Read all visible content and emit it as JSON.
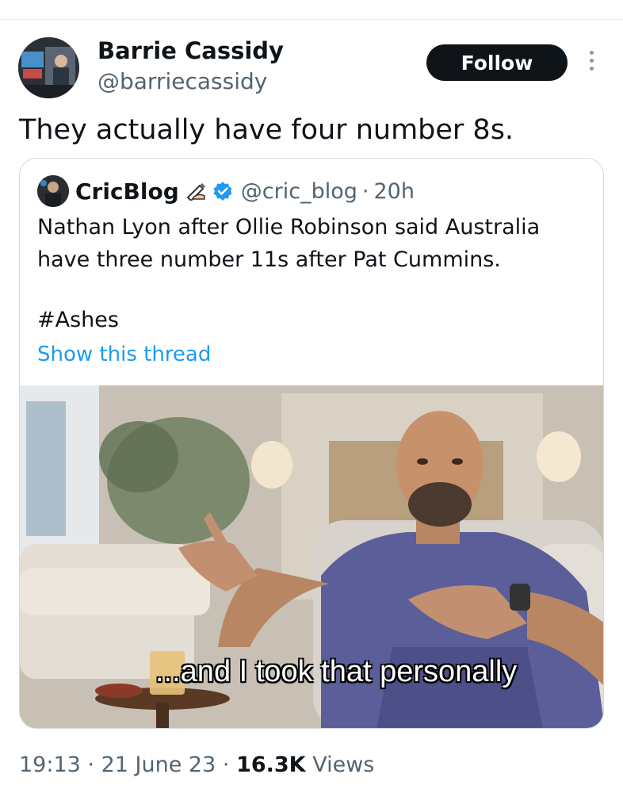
{
  "post": {
    "author_name": "Barrie Cassidy",
    "author_handle": "@barriecassidy",
    "follow_label": "Follow",
    "text": "They actually have four number 8s.",
    "time": "19:13",
    "separator": "·",
    "date": "21 June 23",
    "views_count": "16.3K",
    "views_label": "Views"
  },
  "quoted": {
    "author_name": "CricBlog",
    "author_handle": "@cric_blog",
    "separator": "·",
    "time_ago": "20h",
    "text": "Nathan Lyon after Ollie Robinson said Australia have three number 11s after Pat Cummins.",
    "hashtag": "#Ashes",
    "show_thread_label": "Show this thread",
    "media_caption": "...and I took that personally"
  },
  "icons": {
    "more": "more-options-icon",
    "pen": "writing-hand-icon",
    "verified": "verified-badge-icon"
  },
  "colors": {
    "link": "#1d9bf0",
    "secondary_text": "#536471",
    "follow_button": "#0f1419",
    "verified": "#1d9bf0",
    "caption_highlight": "#f2d21b"
  }
}
